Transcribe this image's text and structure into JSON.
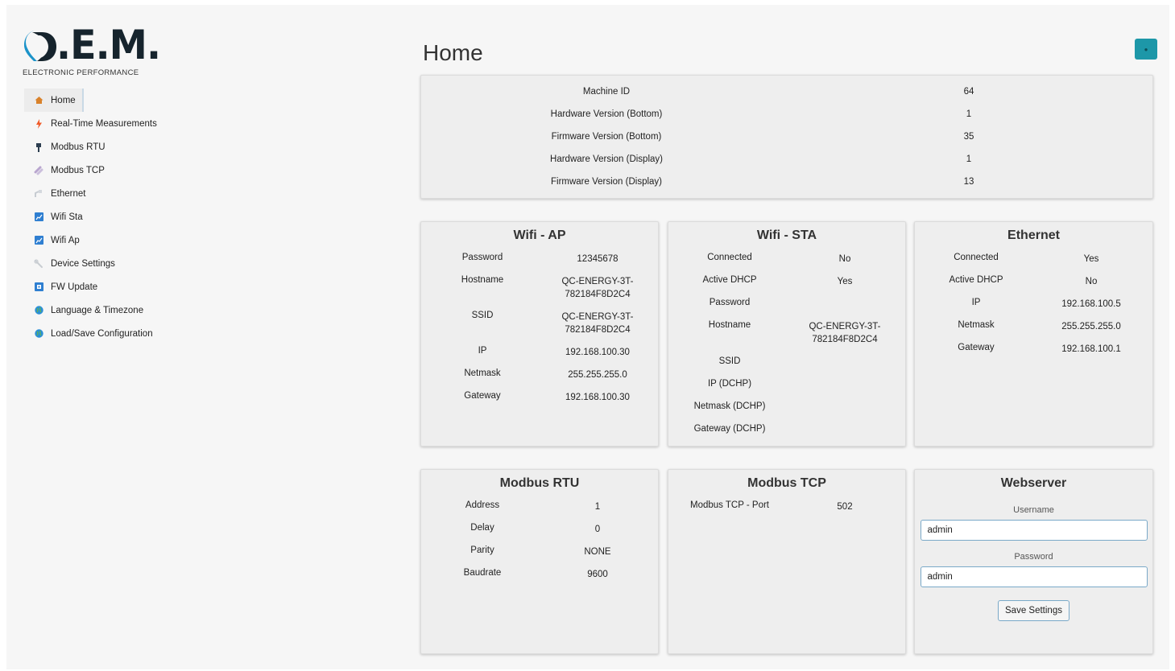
{
  "brand": {
    "logo_text": ".E.M.",
    "tagline": "ELECTRONIC PERFORMANCE"
  },
  "sidebar": {
    "items": [
      {
        "label": "Home",
        "icon": "home-icon",
        "active": true
      },
      {
        "label": "Real-Time Measurements",
        "icon": "bolt-icon"
      },
      {
        "label": "Modbus RTU",
        "icon": "plug-icon"
      },
      {
        "label": "Modbus TCP",
        "icon": "link-icon"
      },
      {
        "label": "Ethernet",
        "icon": "ethernet-icon"
      },
      {
        "label": "Wifi Sta",
        "icon": "wifi-sta-icon"
      },
      {
        "label": "Wifi Ap",
        "icon": "wifi-ap-icon"
      },
      {
        "label": "Device Settings",
        "icon": "wrench-icon"
      },
      {
        "label": "FW Update",
        "icon": "firmware-icon"
      },
      {
        "label": "Language & Timezone",
        "icon": "globe-icon"
      },
      {
        "label": "Load/Save Configuration",
        "icon": "globe-save-icon"
      }
    ]
  },
  "header": {
    "title": "Home",
    "refresh_icon": "refresh-icon",
    "accent_color": "#1d97a8"
  },
  "machine_info": {
    "rows": [
      {
        "label": "Machine ID",
        "value": "64"
      },
      {
        "label": "Hardware Version (Bottom)",
        "value": "1"
      },
      {
        "label": "Firmware Version (Bottom)",
        "value": "35"
      },
      {
        "label": "Hardware Version (Display)",
        "value": "1"
      },
      {
        "label": "Firmware Version (Display)",
        "value": "13"
      }
    ]
  },
  "wifi_ap": {
    "title": "Wifi - AP",
    "rows": [
      {
        "label": "Password",
        "value": "12345678"
      },
      {
        "label": "Hostname",
        "value": "QC-ENERGY-3T-\n782184F8D2C4"
      },
      {
        "label": "SSID",
        "value": "QC-ENERGY-3T-\n782184F8D2C4"
      },
      {
        "label": "IP",
        "value": "192.168.100.30"
      },
      {
        "label": "Netmask",
        "value": "255.255.255.0"
      },
      {
        "label": "Gateway",
        "value": "192.168.100.30"
      }
    ]
  },
  "wifi_sta": {
    "title": "Wifi - STA",
    "rows": [
      {
        "label": "Connected",
        "value": "No"
      },
      {
        "label": "Active DHCP",
        "value": "Yes"
      },
      {
        "label": "Password",
        "value": ""
      },
      {
        "label": "Hostname",
        "value": "QC-ENERGY-3T-\n782184F8D2C4"
      },
      {
        "label": "SSID",
        "value": ""
      },
      {
        "label": "IP (DCHP)",
        "value": ""
      },
      {
        "label": "Netmask (DCHP)",
        "value": ""
      },
      {
        "label": "Gateway (DCHP)",
        "value": ""
      }
    ]
  },
  "ethernet": {
    "title": "Ethernet",
    "rows": [
      {
        "label": "Connected",
        "value": "Yes"
      },
      {
        "label": "Active DHCP",
        "value": "No"
      },
      {
        "label": "IP",
        "value": "192.168.100.5"
      },
      {
        "label": "Netmask",
        "value": "255.255.255.0"
      },
      {
        "label": "Gateway",
        "value": "192.168.100.1"
      }
    ]
  },
  "modbus_rtu": {
    "title": "Modbus RTU",
    "rows": [
      {
        "label": "Address",
        "value": "1"
      },
      {
        "label": "Delay",
        "value": "0"
      },
      {
        "label": "Parity",
        "value": "NONE"
      },
      {
        "label": "Baudrate",
        "value": "9600"
      }
    ]
  },
  "modbus_tcp": {
    "title": "Modbus TCP",
    "rows": [
      {
        "label": "Modbus TCP - Port",
        "value": "502"
      }
    ]
  },
  "webserver": {
    "title": "Webserver",
    "username_label": "Username",
    "username_value": "admin",
    "password_label": "Password",
    "password_value": "admin",
    "save_label": "Save Settings"
  }
}
